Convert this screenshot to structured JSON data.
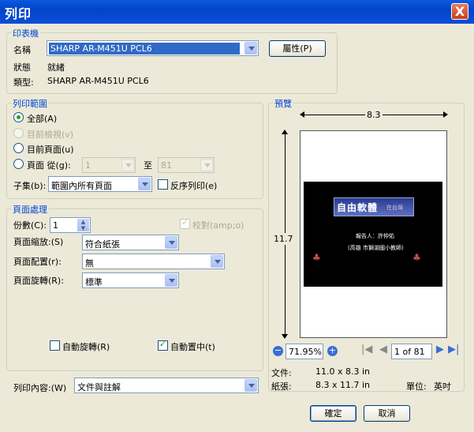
{
  "window": {
    "title": "列印",
    "close_glyph": "X"
  },
  "printer": {
    "legend": "印表機",
    "name_label": "名稱",
    "name_value": "SHARP AR-M451U PCL6",
    "properties_button": "屬性(P)",
    "status_label": "狀態",
    "status_value": "就緒",
    "type_label": "類型:",
    "type_value": "SHARP AR-M451U PCL6"
  },
  "print_range": {
    "legend": "列印範圍",
    "all": "全部(A)",
    "current_view": "目前檢視(v)",
    "current_page": "目前頁面(u)",
    "pages_from": "頁面 從(g):",
    "from_value": "1",
    "to_label": "至",
    "to_value": "81",
    "subset_label": "子集(b):",
    "subset_value": "範圍內所有頁面",
    "reverse_label": "反序列印(e)"
  },
  "page_handling": {
    "legend": "頁面處理",
    "copies_label": "份數(C):",
    "copies_value": "1",
    "collate_label": "校對(amp;o)",
    "scaling_label": "頁面縮放:(S)",
    "scaling_value": "符合紙張",
    "layout_label": "頁面配置(r):",
    "layout_value": "無",
    "rotation_label": "頁面旋轉(R):",
    "rotation_value": "標準",
    "auto_rotate_label": "自動旋轉(R)",
    "auto_center_label": "自動置中(t)"
  },
  "print_what": {
    "label": "列印內容:(W)",
    "value": "文件與註解"
  },
  "preview": {
    "legend": "預覽",
    "width_label": "8.3",
    "height_label": "11.7",
    "slide_title": "自由軟體",
    "slide_title_small": "在台灣",
    "slide_author": "報告人：許仲佑",
    "slide_school": "(高雄 市獅湖國小教師)",
    "zoom_value": "71.95%",
    "page_indicator": "1 of 81",
    "doc_label": "文件:",
    "doc_value": "11.0 x 8.3 in",
    "paper_label": "紙張:",
    "paper_value": "8.3 x 11.7 in",
    "unit_label": "單位:",
    "unit_value": "英吋"
  },
  "buttons": {
    "ok": "確定",
    "cancel": "取消"
  },
  "colors": {
    "titlebar": "#0343c9",
    "legend": "#0046d5",
    "accent_green": "#21a121",
    "selection": "#316ac5"
  }
}
